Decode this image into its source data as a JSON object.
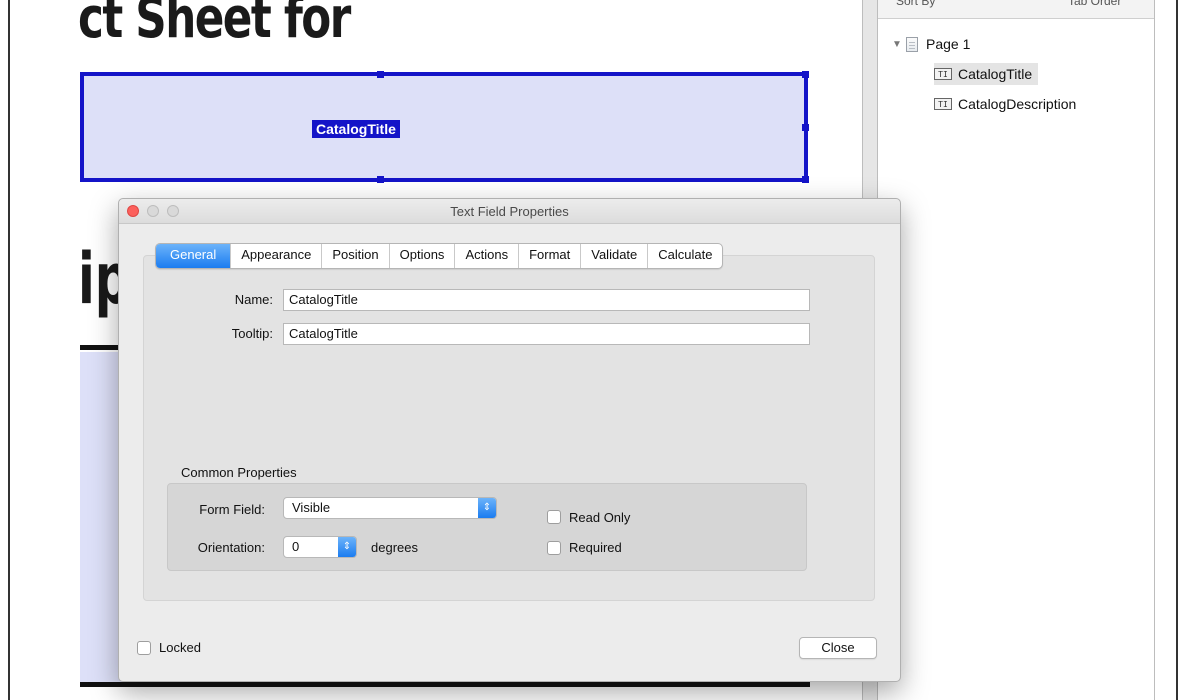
{
  "document": {
    "heading_fragment": "ct Sheet for",
    "heading2_fragment": "ip",
    "selected_field_tag": "CatalogTitle"
  },
  "fields_panel": {
    "header_left": "Sort By",
    "header_right": "Tab Order",
    "page_label": "Page 1",
    "items": [
      {
        "label": "CatalogTitle",
        "icon": "text-field-icon",
        "selected": true
      },
      {
        "label": "CatalogDescription",
        "icon": "text-field-icon",
        "selected": false
      }
    ]
  },
  "dialog": {
    "title": "Text Field Properties",
    "tabs": [
      "General",
      "Appearance",
      "Position",
      "Options",
      "Actions",
      "Format",
      "Validate",
      "Calculate"
    ],
    "active_tab": "General",
    "name_label": "Name:",
    "name_value": "CatalogTitle",
    "tooltip_label": "Tooltip:",
    "tooltip_value": "CatalogTitle",
    "common_properties_title": "Common Properties",
    "form_field_label": "Form Field:",
    "form_field_value": "Visible",
    "orientation_label": "Orientation:",
    "orientation_value": "0",
    "orientation_unit": "degrees",
    "read_only_label": "Read Only",
    "required_label": "Required",
    "locked_label": "Locked",
    "close_label": "Close"
  },
  "colors": {
    "selection_blue": "#1414c8",
    "field_fill": "#dde0f8",
    "tab_active": "#1b7cf0",
    "close_button_red": "#fc605c"
  }
}
